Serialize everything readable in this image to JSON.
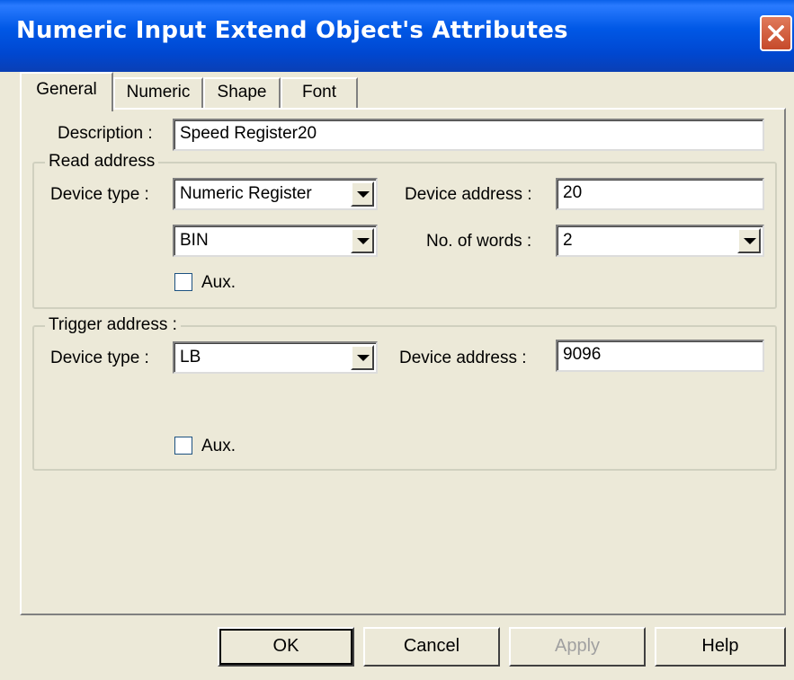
{
  "window": {
    "title": "Numeric Input Extend Object's Attributes"
  },
  "tabs": [
    {
      "label": "General",
      "active": true
    },
    {
      "label": "Numeric",
      "active": false
    },
    {
      "label": "Shape",
      "active": false
    },
    {
      "label": "Font",
      "active": false
    }
  ],
  "description": {
    "label": "Description :",
    "value": "Speed Register20"
  },
  "read_address": {
    "title": "Read address",
    "device_type_label": "Device type :",
    "device_type_value": "Numeric Register",
    "device_address_label": "Device address :",
    "device_address_value": "20",
    "format_value": "BIN",
    "words_label": "No. of words :",
    "words_value": "2",
    "aux_label": "Aux.",
    "aux_checked": false
  },
  "trigger_address": {
    "title": "Trigger address :",
    "device_type_label": "Device type :",
    "device_type_value": "LB",
    "device_address_label": "Device  address :",
    "device_address_value": "9096",
    "aux_label": "Aux.",
    "aux_checked": false
  },
  "buttons": {
    "ok": "OK",
    "cancel": "Cancel",
    "apply": "Apply",
    "help": "Help"
  }
}
